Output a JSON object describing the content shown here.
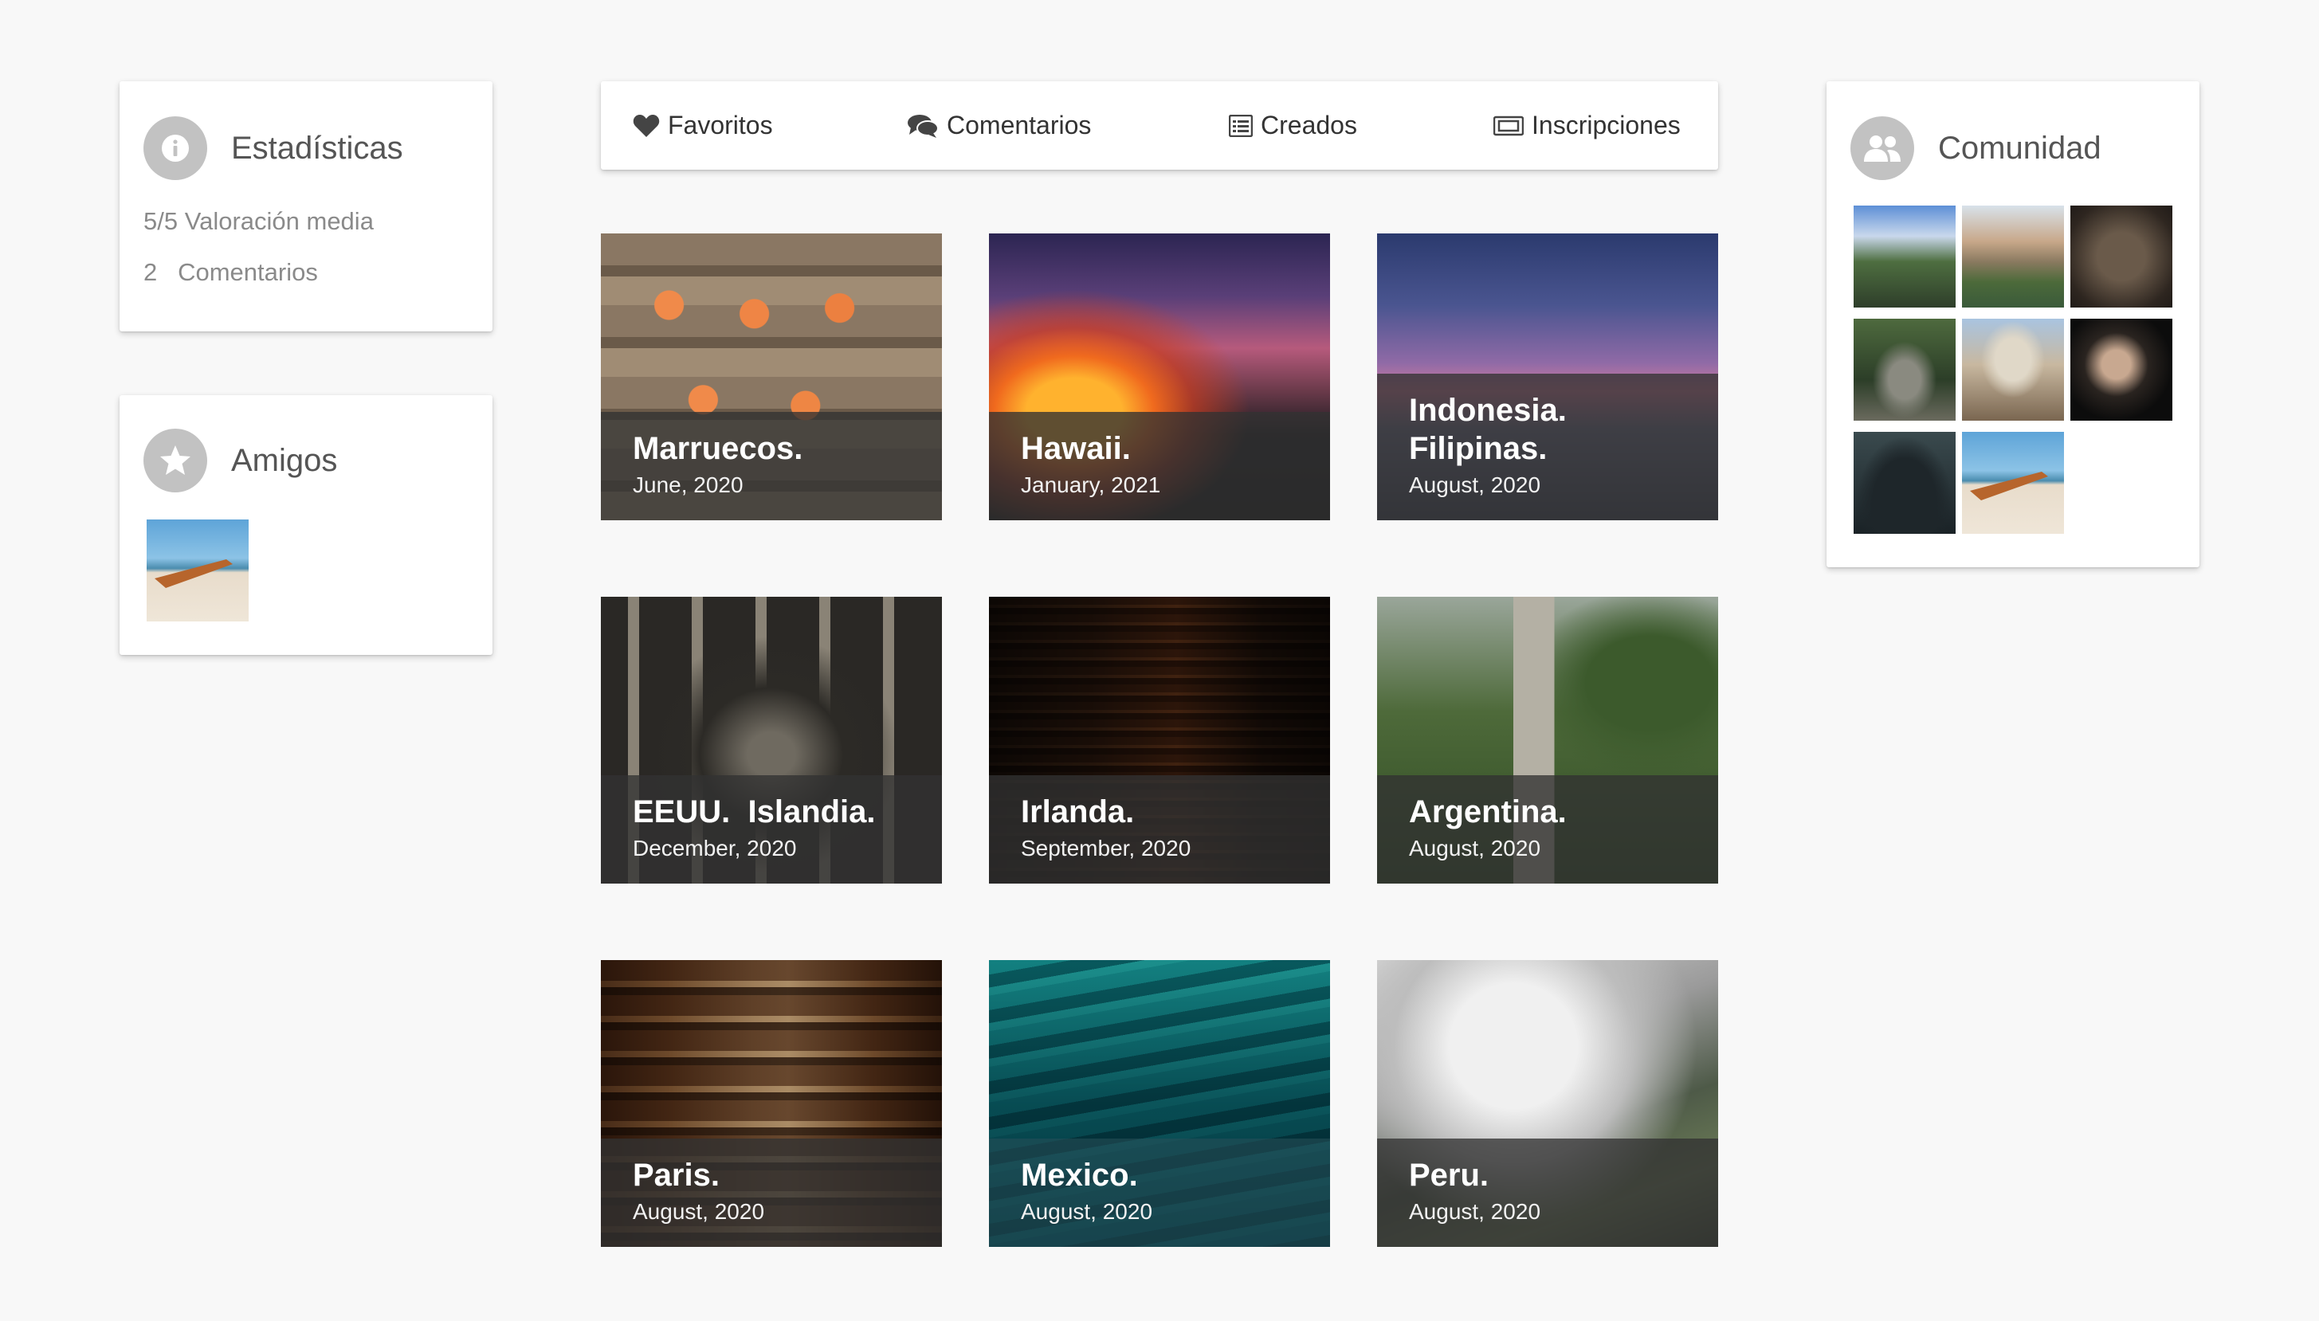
{
  "stats": {
    "title": "Estadísticas",
    "rating": "5/5 Valoración media",
    "comments": "2   Comentarios"
  },
  "friends": {
    "title": "Amigos"
  },
  "tabs": [
    {
      "label": "Favoritos",
      "icon": "heart-icon"
    },
    {
      "label": "Comentarios",
      "icon": "comments-icon"
    },
    {
      "label": "Creados",
      "icon": "list-icon"
    },
    {
      "label": "Inscripciones",
      "icon": "ticket-icon"
    }
  ],
  "trips": [
    {
      "name": "Marruecos.",
      "date": "June, 2020"
    },
    {
      "name": "Hawaii.",
      "date": "January, 2021"
    },
    {
      "name": "Indonesia. Filipinas.",
      "date": "August, 2020"
    },
    {
      "name": "EEUU.  Islandia.",
      "date": "December, 2020"
    },
    {
      "name": "Irlanda.",
      "date": "September, 2020"
    },
    {
      "name": "Argentina.",
      "date": "August, 2020"
    },
    {
      "name": "Paris.",
      "date": "August, 2020"
    },
    {
      "name": "Mexico.",
      "date": "August, 2020"
    },
    {
      "name": "Peru.",
      "date": "August, 2020"
    }
  ],
  "community": {
    "title": "Comunidad"
  },
  "colors": {
    "background": "#f8f8f8",
    "icon_circle": "#c2c2c2",
    "overlay": "#323232"
  }
}
